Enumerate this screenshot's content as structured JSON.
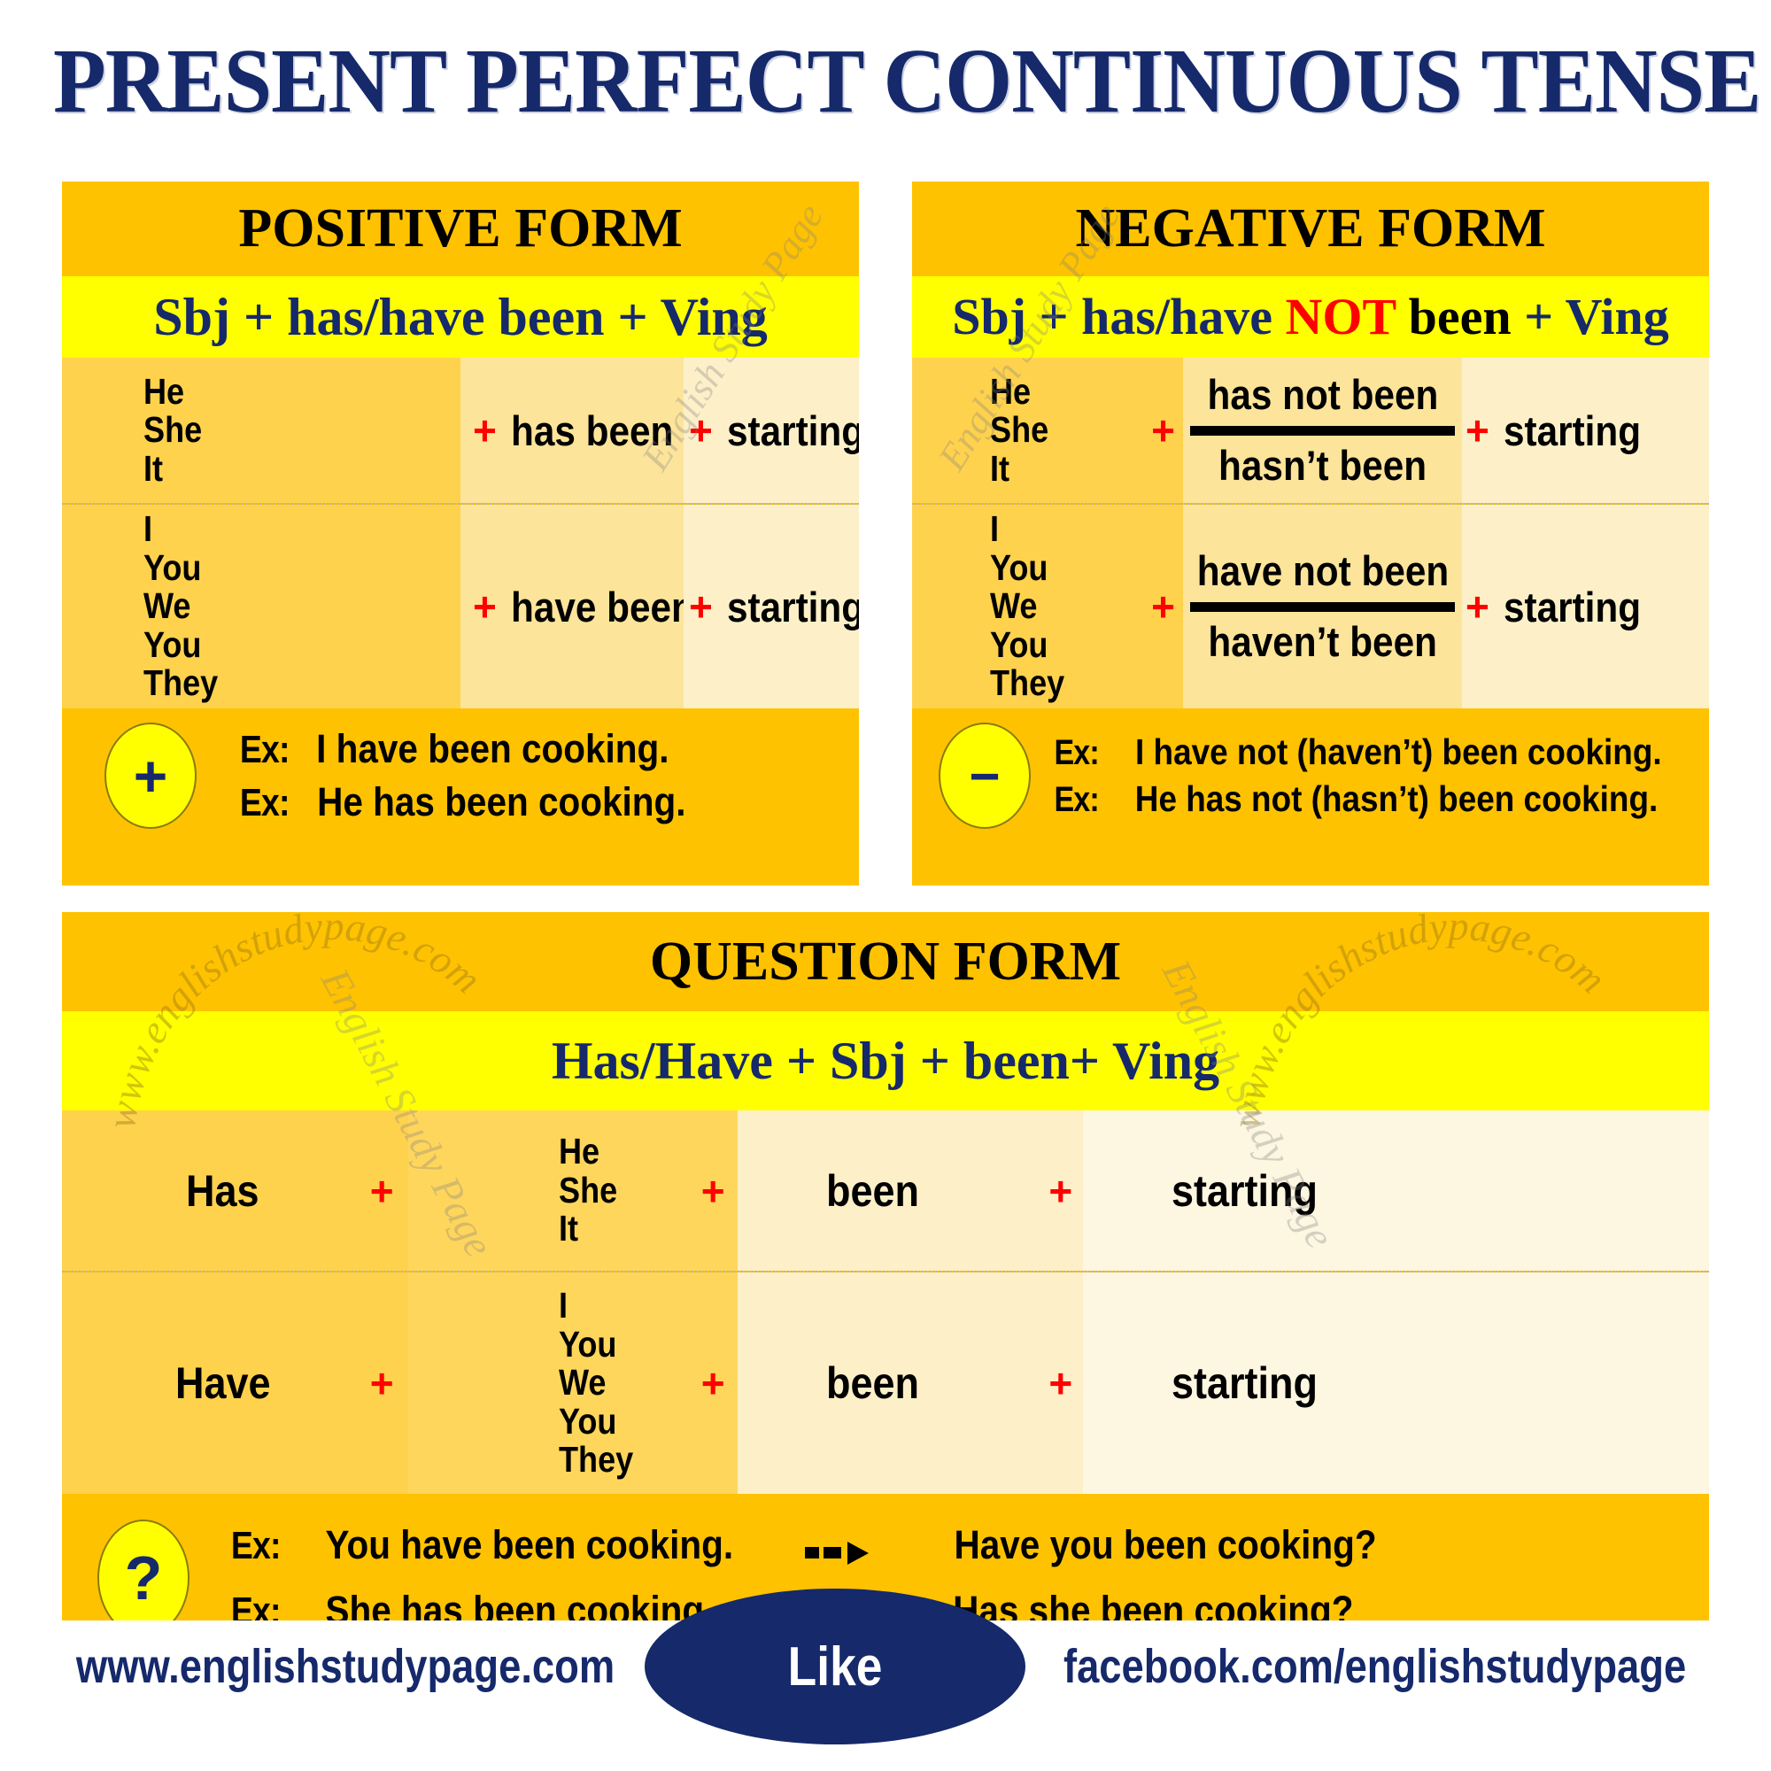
{
  "title": "PRESENT PERFECT CONTINUOUS TENSE",
  "colors": {
    "navy": "#15296b",
    "orange": "#ffc200",
    "yellow": "#ffff00",
    "red": "#ff0000",
    "col_dark": "#ffd24d",
    "col_mid": "#fce49a",
    "col_light": "#fdf0c8",
    "col_pale": "#fdf6e0"
  },
  "positive": {
    "heading": "POSITIVE FORM",
    "formula": {
      "part1": "Sbj + has/have been + Ving"
    },
    "rows": [
      {
        "pronouns": [
          "He",
          "She",
          "It"
        ],
        "plus1": "+",
        "aux": "has been",
        "plus2": "+",
        "verb": "starting"
      },
      {
        "pronouns": [
          "I",
          "You",
          "We",
          "You",
          "They"
        ],
        "plus1": "+",
        "aux": "have been",
        "plus2": "+",
        "verb": "starting"
      }
    ],
    "badge": "+",
    "examples": [
      {
        "tag": "Ex:",
        "text": "I have been cooking."
      },
      {
        "tag": "Ex:",
        "text": "He has been cooking."
      }
    ]
  },
  "negative": {
    "heading": "NEGATIVE FORM",
    "formula": {
      "pre": "Sbj + has/have ",
      "not": "NOT",
      "mid": " been",
      "post": " + Ving"
    },
    "rows": [
      {
        "pronouns": [
          "He",
          "She",
          "It"
        ],
        "plus1": "+",
        "aux_long": "has not been",
        "aux_short": "hasn’t been",
        "plus2": "+",
        "verb": "starting"
      },
      {
        "pronouns": [
          "I",
          "You",
          "We",
          "You",
          "They"
        ],
        "plus1": "+",
        "aux_long": "have not been",
        "aux_short": "haven’t been",
        "plus2": "+",
        "verb": "starting"
      }
    ],
    "badge": "−",
    "examples": [
      {
        "tag": "Ex:",
        "text": "I have not (haven’t) been cooking."
      },
      {
        "tag": "Ex:",
        "text": "He has not (hasn’t) been cooking."
      }
    ]
  },
  "question": {
    "heading": "QUESTION FORM",
    "formula": "Has/Have +  Sbj + been+ Ving",
    "rows": [
      {
        "aux": "Has",
        "plus1": "+",
        "pronouns": [
          "He",
          "She",
          "It"
        ],
        "plus2": "+",
        "been": "been",
        "plus3": "+",
        "verb": "starting"
      },
      {
        "aux": "Have",
        "plus1": "+",
        "pronouns": [
          "I",
          "You",
          "We",
          "You",
          "They"
        ],
        "plus2": "+",
        "been": "been",
        "plus3": "+",
        "verb": "starting"
      }
    ],
    "badge": "?",
    "examples": [
      {
        "tag": "Ex:",
        "statement": "You have been cooking.",
        "question": "Have you been cooking?"
      },
      {
        "tag": "Ex:",
        "statement": "She has been cooking.",
        "question": "Has she been cooking?"
      }
    ]
  },
  "watermarks": {
    "arc": "www.englishstudypage.com",
    "diagonal": "English Study Page"
  },
  "footer": {
    "website": "www.englishstudypage.com",
    "like": "Like",
    "facebook": "facebook.com/englishstudypage"
  }
}
